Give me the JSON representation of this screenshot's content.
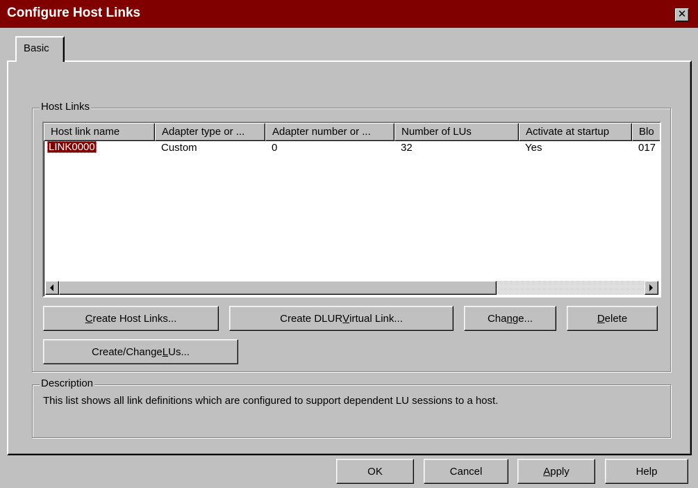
{
  "window": {
    "title": "Configure Host Links",
    "close_glyph": "✕"
  },
  "tabs": [
    {
      "label": "Basic",
      "selected": true
    }
  ],
  "host_links_group": {
    "title": "Host Links",
    "columns": [
      "Host link name",
      "Adapter type or ...",
      "Adapter number or ...",
      "Number of LUs",
      "Activate at startup",
      "Blo"
    ],
    "rows": [
      {
        "name": "LINK0000",
        "adapter_type": "Custom",
        "adapter_number": "0",
        "number_of_lus": "32",
        "activate_at_startup": "Yes",
        "block": "017",
        "selected": true
      }
    ],
    "buttons": {
      "create_host_links": {
        "pre": "",
        "key": "C",
        "post": "reate Host Links..."
      },
      "create_dlur": {
        "pre": "Create DLUR ",
        "key": "V",
        "post": "irtual Link..."
      },
      "change": {
        "pre": "Cha",
        "key": "n",
        "post": "ge..."
      },
      "delete": {
        "pre": "",
        "key": "D",
        "post": "elete"
      },
      "create_change_lus": {
        "pre": "Create/Change ",
        "key": "L",
        "post": "Us..."
      }
    }
  },
  "description_group": {
    "title": "Description",
    "text": "This list shows all link definitions which are configured to support dependent LU sessions to a host."
  },
  "dialog_buttons": {
    "ok": "OK",
    "cancel": "Cancel",
    "apply": {
      "pre": "",
      "key": "A",
      "post": "pply"
    },
    "help": "Help"
  },
  "colors": {
    "title_bar": "#800000",
    "face": "#c0c0c0",
    "selection": "#800000"
  }
}
